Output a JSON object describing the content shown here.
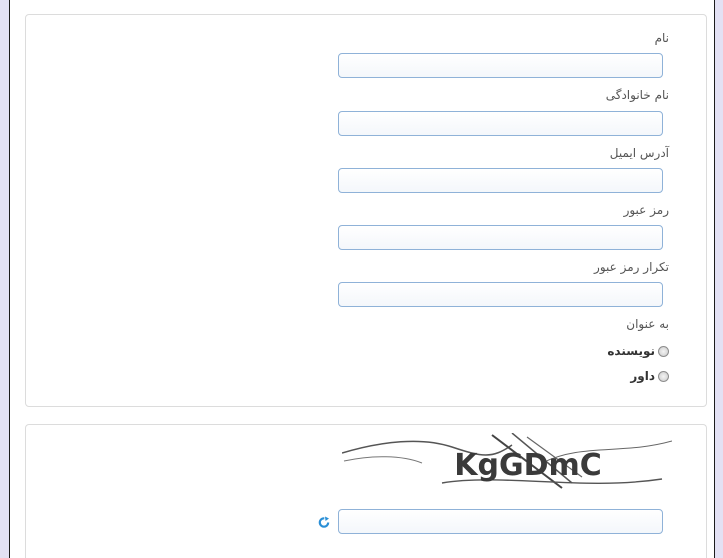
{
  "form": {
    "first_name_label": "نام",
    "last_name_label": "نام خانوادگی",
    "email_label": "آدرس ایمیل",
    "password_label": "رمز عبور",
    "password_repeat_label": "تکرار رمز عبور",
    "role_label": "به عنوان",
    "role_options": [
      "نویسنده",
      "داور"
    ],
    "first_name_value": "",
    "last_name_value": "",
    "email_value": "",
    "password_value": "",
    "password_repeat_value": ""
  },
  "captcha": {
    "text": "KgGDmC",
    "input_value": "",
    "refresh_icon": "refresh-icon",
    "accent": "#2a8fd6"
  }
}
